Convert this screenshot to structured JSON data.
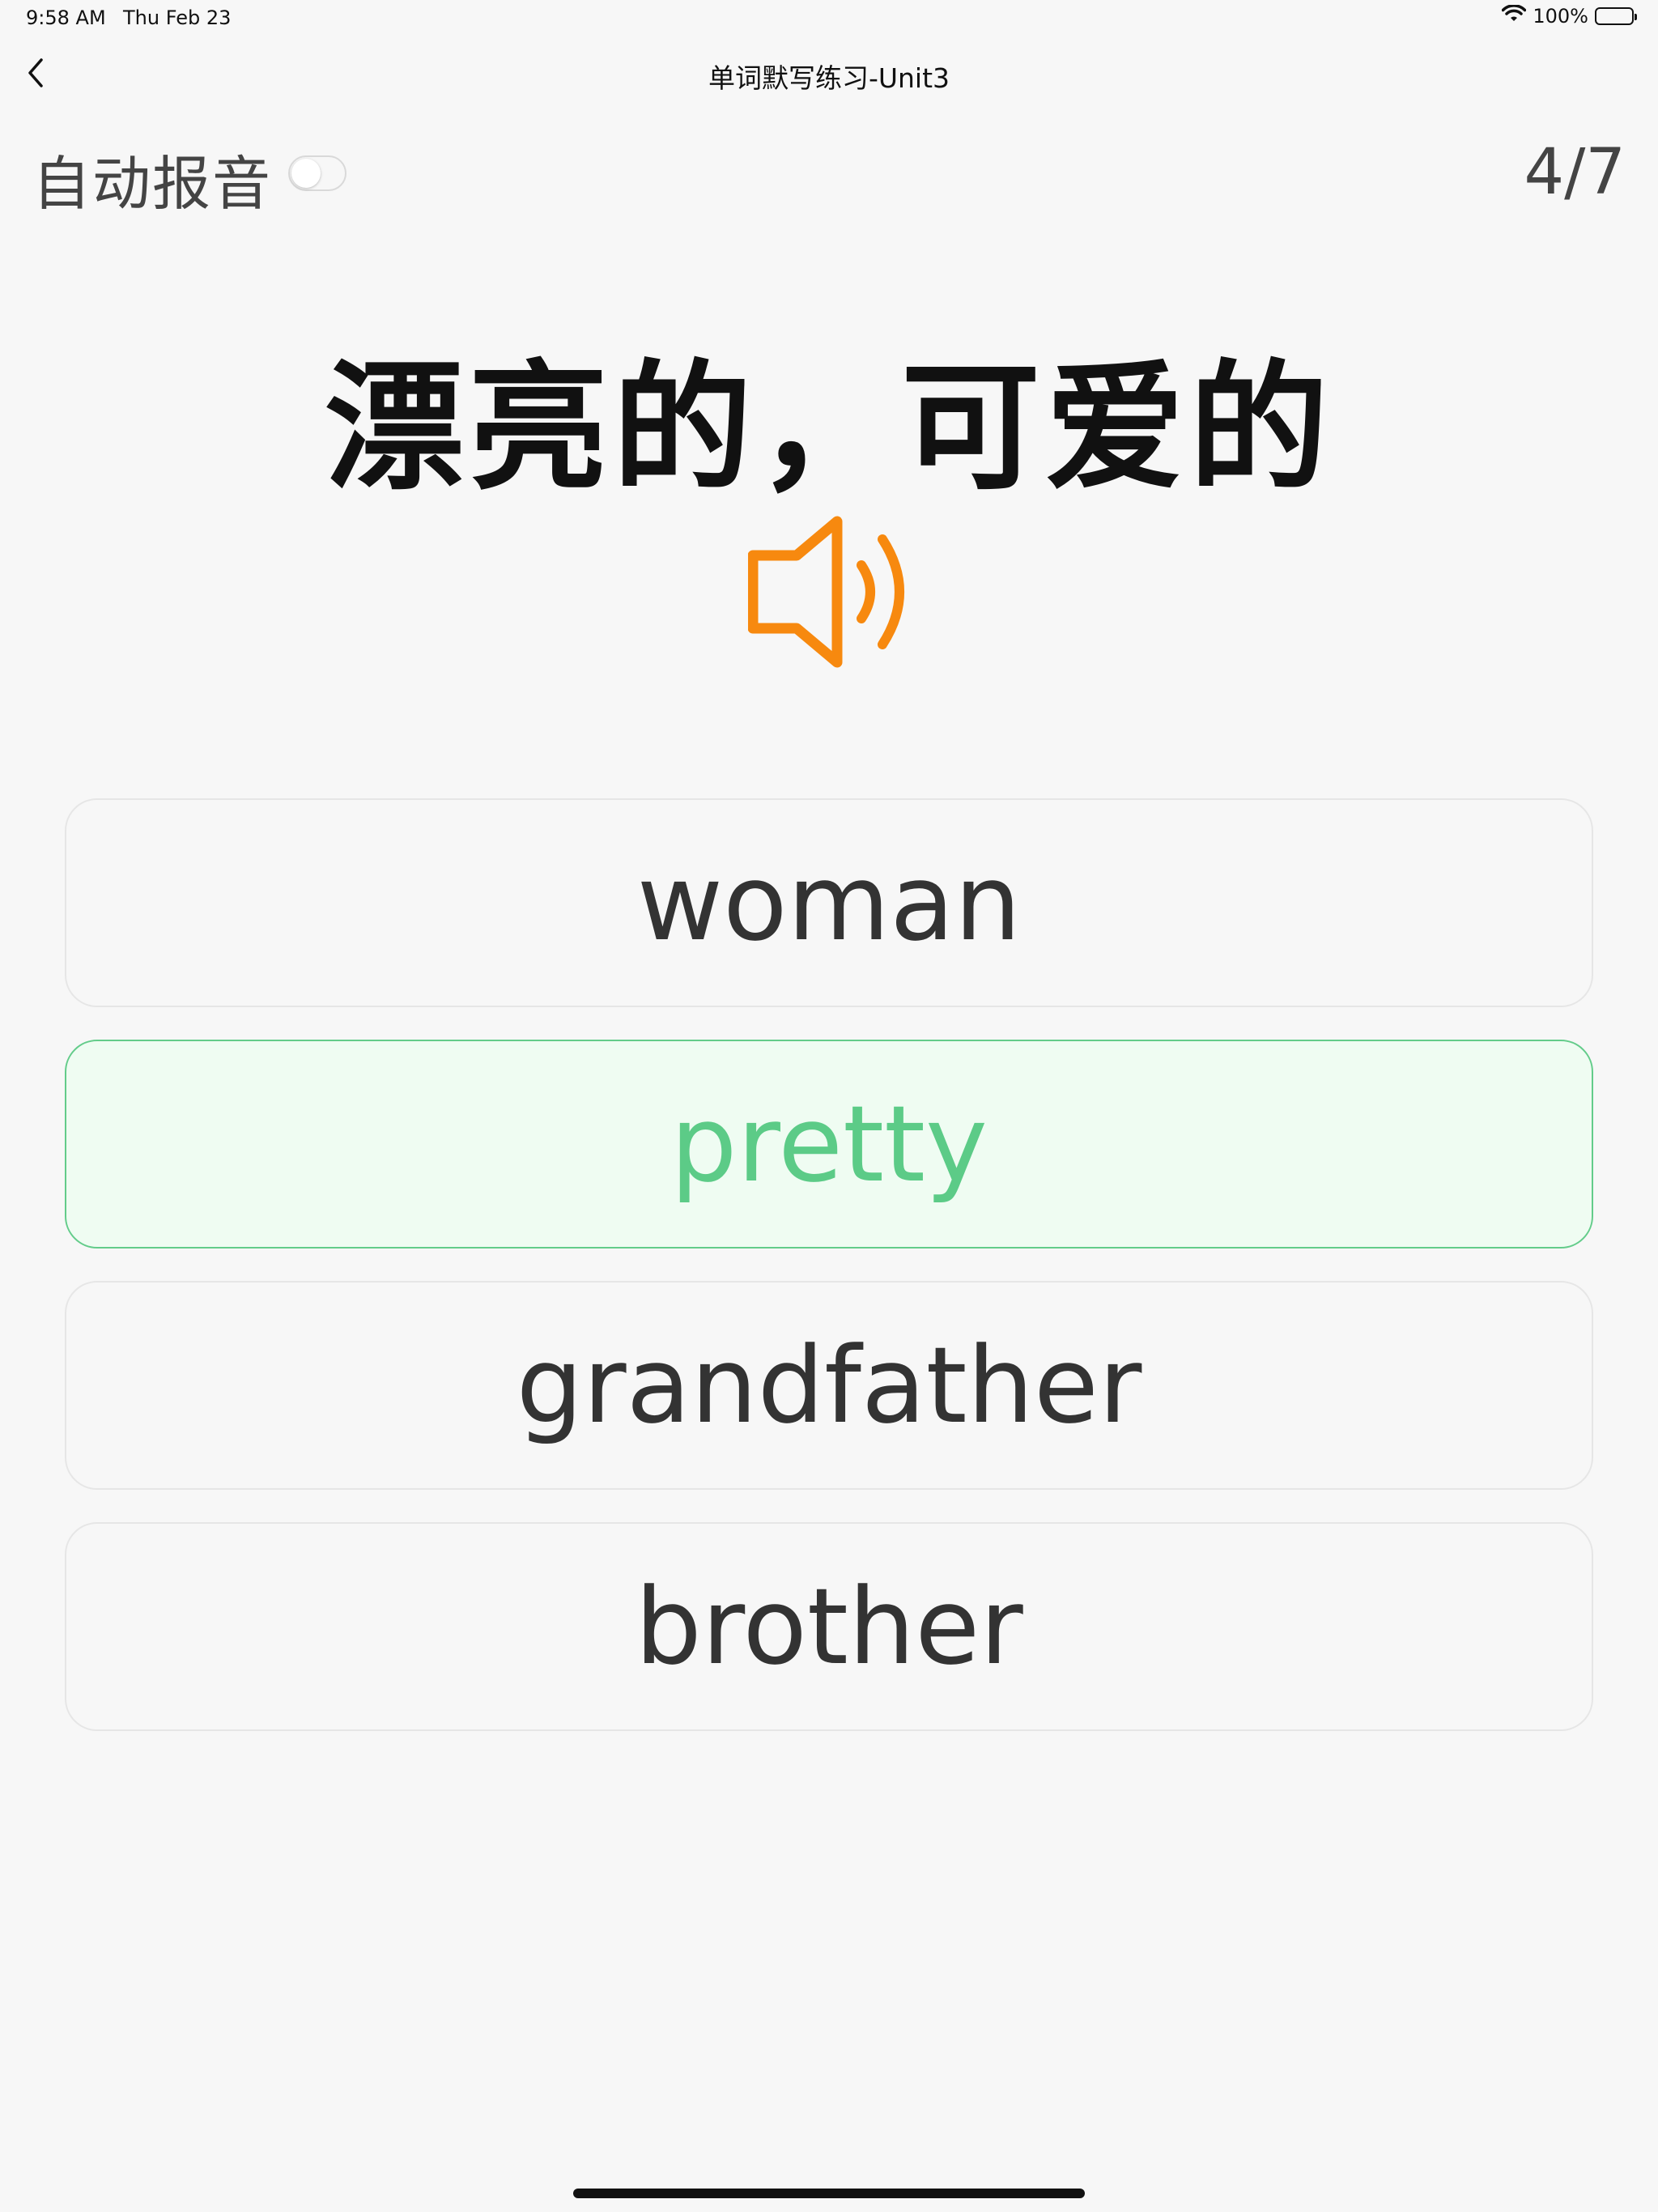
{
  "status_bar": {
    "time": "9:58 AM",
    "date": "Thu Feb 23",
    "battery": "100%",
    "wifi_icon": "wifi-icon",
    "battery_icon": "battery-icon"
  },
  "nav": {
    "back_icon": "chevron-left-icon",
    "title": "单词默写练习-Unit3"
  },
  "settings": {
    "auto_pronounce_label": "自动报音",
    "auto_pronounce_on": false
  },
  "progress": "4/7",
  "question": {
    "prompt": "漂亮的，可爱的",
    "speaker_icon": "speaker-icon",
    "speaker_color": "#f7890f"
  },
  "options": [
    {
      "label": "woman",
      "state": "normal"
    },
    {
      "label": "pretty",
      "state": "correct"
    },
    {
      "label": "grandfather",
      "state": "normal"
    },
    {
      "label": "brother",
      "state": "normal"
    }
  ],
  "colors": {
    "correct_text": "#5ccb87",
    "correct_border": "#63cc8a",
    "correct_bg": "#effcf2"
  }
}
